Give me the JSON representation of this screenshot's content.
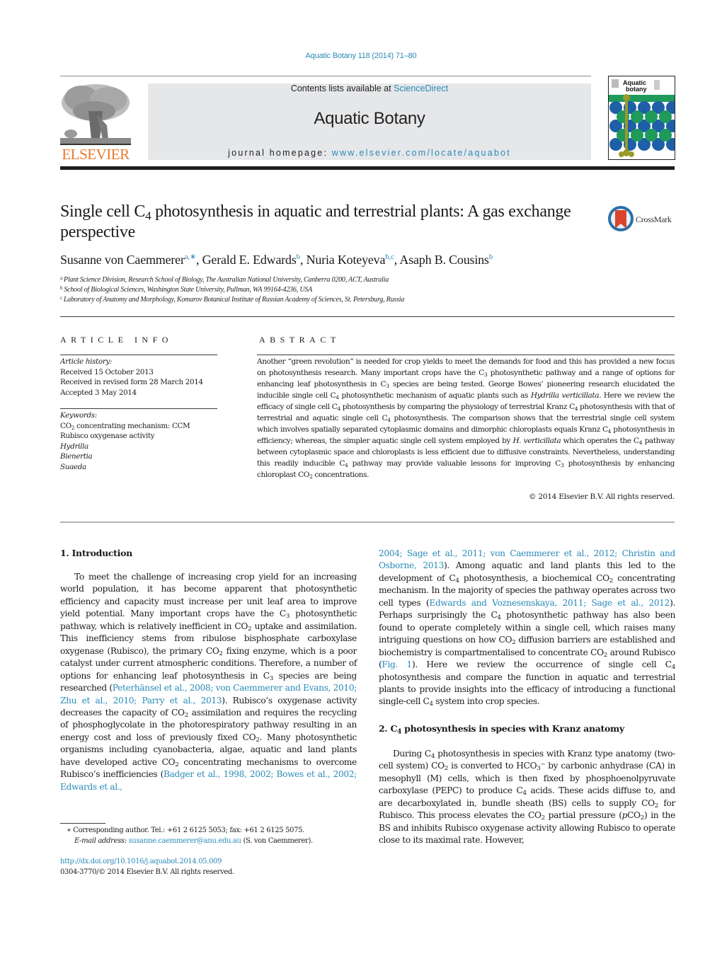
{
  "header": {
    "citation": "Aquatic Botany 118 (2014) 71–80",
    "publisher_wordmark": "ELSEVIER",
    "contents_prefix": "Contents lists available at ",
    "contents_link": "ScienceDirect",
    "journal_title": "Aquatic Botany",
    "homepage_prefix": "journal homepage: ",
    "homepage_link": "www.elsevier.com/locate/aquabot",
    "cover_title_line1": "Aquatic",
    "cover_title_line2": "botany",
    "crossmark_label": "CrossMark"
  },
  "colors": {
    "link": "#2a8ab8",
    "elsevier_orange": "#e8782a",
    "journal_box": "#e6e7e9",
    "crossmark_red": "#d9452b",
    "crossmark_blue": "#2a6fa8",
    "cover_green": "#1e9a5a",
    "cover_blue": "#1f5fa8",
    "cover_olive": "#9a9a2a"
  },
  "article": {
    "title_part1": "Single cell C",
    "title_sub": "4",
    "title_part2": " photosynthesis in aquatic and terrestrial plants: A gas exchange perspective",
    "authors": [
      {
        "name": "Susanne von Caemmerer",
        "affil": "a,∗"
      },
      {
        "name": "Gerald E. Edwards",
        "affil": "b"
      },
      {
        "name": "Nuria Koteyeva",
        "affil": "b,c"
      },
      {
        "name": "Asaph B. Cousins",
        "affil": "b"
      }
    ],
    "affiliations": [
      {
        "key": "a",
        "text": "Plant Science Division, Research School of Biology, The Australian National University, Canberra 0200, ACT, Australia"
      },
      {
        "key": "b",
        "text": "School of Biological Sciences, Washington State University, Pullman, WA 99164-4236, USA"
      },
      {
        "key": "c",
        "text": "Laboratory of Anatomy and Morphology, Komarov Botanical Institute of Russian Academy of Sciences, St. Petersburg, Russia"
      }
    ]
  },
  "article_info": {
    "heading": "ARTICLE INFO",
    "history_label": "Article history:",
    "history": [
      "Received 15 October 2013",
      "Received in revised form 28 March 2014",
      "Accepted 3 May 2014"
    ],
    "keywords_label": "Keywords:",
    "keywords": [
      {
        "pre": "CO",
        "sub": "2",
        "post": " concentrating mechanism: CCM",
        "italic": false
      },
      {
        "pre": "Rubisco oxygenase activity",
        "sub": "",
        "post": "",
        "italic": false
      },
      {
        "pre": "Hydrilla",
        "sub": "",
        "post": "",
        "italic": true
      },
      {
        "pre": "Bienertia",
        "sub": "",
        "post": "",
        "italic": true
      },
      {
        "pre": "Suaeda",
        "sub": "",
        "post": "",
        "italic": true
      }
    ]
  },
  "abstract": {
    "heading": "ABSTRACT",
    "t1": "Another “green revolution” is needed for crop yields to meet the demands for food and this has provided a new focus on photosynthesis research. Many important crops have the C",
    "t2": " photosynthetic pathway and a range of options for enhancing leaf photosynthesis in C",
    "t3": " species are being tested. George Bowes’ pioneering research elucidated the inducible single cell C",
    "t4": " photosynthetic mechanism of aquatic plants such as ",
    "t5_italic": "Hydrilla verticillata",
    "t6": ". Here we review the efficacy of single cell C",
    "t7": " photosynthesis by comparing the physiology of terrestrial Kranz C",
    "t8": " photosynthesis with that of terrestrial and aquatic single cell C",
    "t9": " photosynthesis. The comparison shows that the terrestrial single cell system which involves spatially separated cytoplasmic domains and dimorphic chloroplasts equals Kranz C",
    "t10": " photosynthesis in efficiency; whereas, the simpler aquatic single cell system employed by ",
    "t11_italic": "H. verticillata",
    "t12": " which operates the C",
    "t13": " pathway between cytoplasmic space and chloroplasts is less efficient due to diffusive constraints. Nevertheless, understanding this readily inducible C",
    "t14": " pathway may provide valuable lessons for improving C",
    "t15": " photosynthesis by enhancing chloroplast CO",
    "t16": " concentrations.",
    "copyright": "© 2014 Elsevier B.V. All rights reserved."
  },
  "body": {
    "sec1_heading": "1.  Introduction",
    "sec2_heading_pre": "2.  C",
    "sec2_heading_post": " photosynthesis in species with Kranz anatomy",
    "p1_a": "To meet the challenge of increasing crop yield for an increasing world population, it has become apparent that photosynthetic efficiency and capacity must increase per unit leaf area to improve yield potential. Many important crops have the C",
    "p1_b": " photosynthetic pathway, which is relatively inefficient in CO",
    "p1_c": " uptake and assimilation. This inefficiency stems from ribulose bisphosphate carboxylase oxygenase (Rubisco), the primary CO",
    "p1_d": " fixing enzyme, which is a poor catalyst under current atmospheric conditions. Therefore, a number of options for enhancing leaf photosynthesis in C",
    "p1_e": " species are being researched (",
    "p1_ref1": "Peterhänsel et al., 2008; von Caemmerer and Evans, 2010; Zhu et al., 2010; Parry et al., 2013",
    "p1_f": "). Rubisco’s oxygenase activity decreases the capacity of CO",
    "p1_g": " assimilation and requires the recycling of phosphoglycolate in the photorespiratory pathway resulting in an energy cost and loss of previously fixed CO",
    "p1_h": ". Many photosynthetic organisms including cyanobacteria, algae, aquatic and land plants have developed active CO",
    "p1_i": " concentrating mechanisms to overcome Rubisco’s inefficiencies (",
    "p1_ref2": "Badger et al., 1998, 2002; Bowes et al., 2002; Edwards et al.,",
    "p1_ref3": "2004; Sage et al., 2011; von Caemmerer et al., 2012; Christin and Osborne, 2013",
    "p1_j": "). Among aquatic and land plants this led to the development of C",
    "p1_k": " photosynthesis, a biochemical CO",
    "p1_l": " concentrating mechanism. In the majority of species the pathway operates across two cell types (",
    "p1_ref4": "Edwards and Voznesenskaya, 2011; Sage et al., 2012",
    "p1_m": "). Perhaps surprisingly the C",
    "p1_n": " photosynthetic pathway has also been found to operate completely within a single cell, which raises many intriguing questions on how CO",
    "p1_o": " diffusion barriers are established and biochemistry is compartmentalised to concentrate CO",
    "p1_p": " around Rubisco (",
    "p1_ref5": "Fig. 1",
    "p1_q": "). Here we review the occurrence of single cell C",
    "p1_r": " photosynthesis and compare the function in aquatic and terrestrial plants to provide insights into the efficacy of introducing a functional single-cell C",
    "p1_s": " system into crop species.",
    "p2_a": "During C",
    "p2_b": " photosynthesis in species with Kranz type anatomy (two-cell system) CO",
    "p2_c": " is converted to HCO",
    "p2_c_sub": "3",
    "p2_c_sup": "−",
    "p2_d": " by carbonic anhydrase (CA) in mesophyll (M) cells, which is then fixed by phosphoenolpyruvate carboxylase (PEPC) to produce C",
    "p2_e": " acids. These acids diffuse to, and are decarboxylated in, bundle sheath (BS) cells to supply CO",
    "p2_f": " for Rubisco. This process elevates the CO",
    "p2_g": " partial pressure (",
    "p2_g_italic": "p",
    "p2_h": "CO",
    "p2_i": ") in the BS and inhibits Rubisco oxygenase activity allowing Rubisco to operate close to its maximal rate. However,",
    "sub2": "2",
    "sub3": "3",
    "sub4": "4"
  },
  "footnote": {
    "mark": "∗",
    "corresponding": " Corresponding author. Tel.: +61 2 6125 5053; fax: +61 2 6125 5075.",
    "email_label": "E-mail address:",
    "email": "susanne.caemmerer@anu.edu.au",
    "email_suffix": " (S. von Caemmerer).",
    "doi": "http://dx.doi.org/10.1016/j.aquabot.2014.05.009",
    "issn_copyright": "0304-3770/© 2014 Elsevier B.V. All rights reserved."
  }
}
